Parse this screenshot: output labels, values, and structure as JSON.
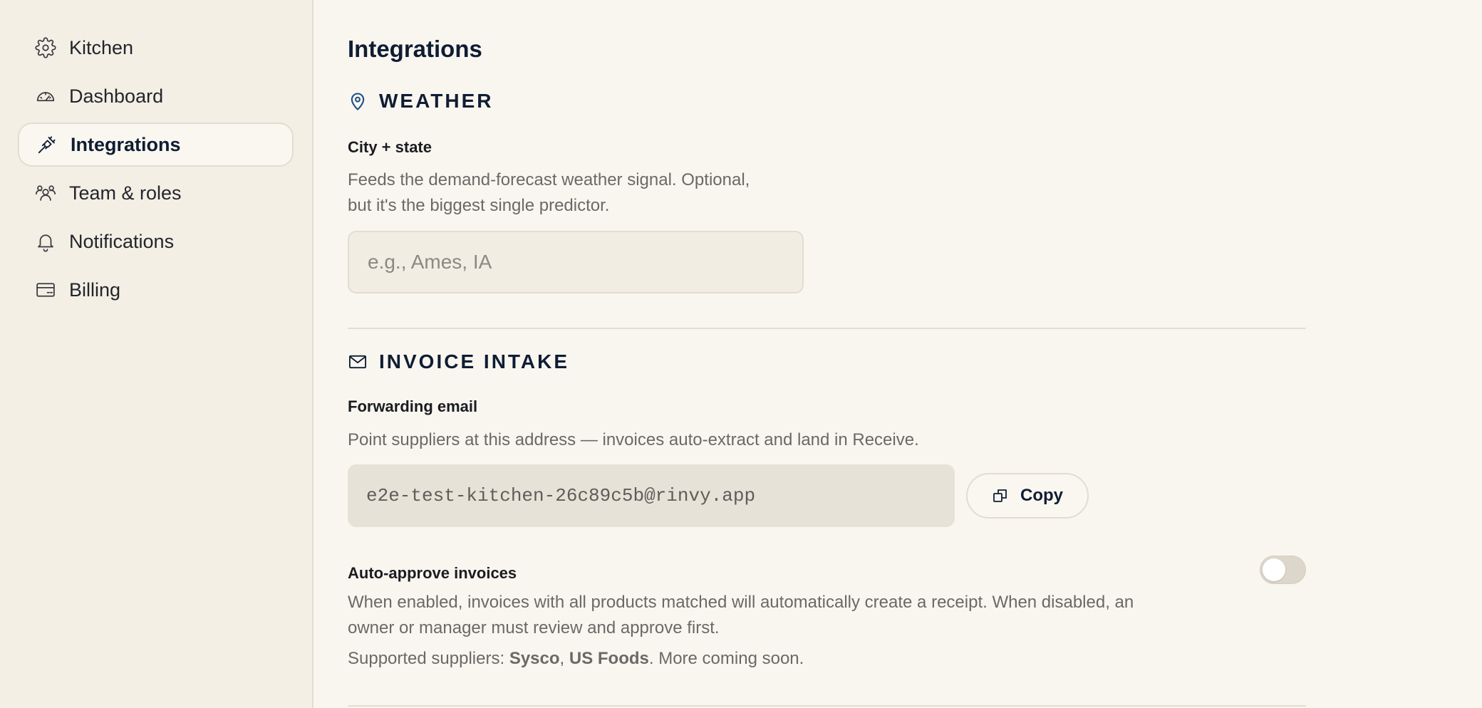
{
  "sidebar": {
    "items": [
      {
        "label": "Kitchen",
        "icon": "gear-icon"
      },
      {
        "label": "Dashboard",
        "icon": "gauge-icon"
      },
      {
        "label": "Integrations",
        "icon": "plug-icon",
        "active": true
      },
      {
        "label": "Team & roles",
        "icon": "users-icon"
      },
      {
        "label": "Notifications",
        "icon": "bell-icon"
      },
      {
        "label": "Billing",
        "icon": "credit-card-icon"
      }
    ]
  },
  "page": {
    "title": "Integrations"
  },
  "weather": {
    "heading": "WEATHER",
    "icon": "map-pin-icon",
    "field_label": "City + state",
    "help_line1": "Feeds the demand-forecast weather signal. Optional,",
    "help_line2": "but it's the biggest single predictor.",
    "placeholder": "e.g., Ames, IA",
    "value": ""
  },
  "invoice": {
    "heading": "INVOICE INTAKE",
    "icon": "mail-icon",
    "field_label": "Forwarding email",
    "help": "Point suppliers at this address — invoices auto-extract and land in Receive.",
    "email": "e2e-test-kitchen-26c89c5b@rinvy.app",
    "copy_label": "Copy",
    "auto_approve": {
      "label": "Auto-approve invoices",
      "enabled": false,
      "help_line1": "When enabled, invoices with all products matched will automatically create a receipt. When disabled, an",
      "help_line2": "owner or manager must review and approve first."
    },
    "suppliers": {
      "prefix": "Supported suppliers: ",
      "supplier1": "Sysco",
      "separator": ", ",
      "supplier2": "US Foods",
      "suffix": ". More coming soon."
    }
  },
  "colors": {
    "background": "#f9f6f0",
    "sidebar": "#f3efe5",
    "heading": "#0f1d33",
    "accent_icon": "#1f4f86"
  }
}
